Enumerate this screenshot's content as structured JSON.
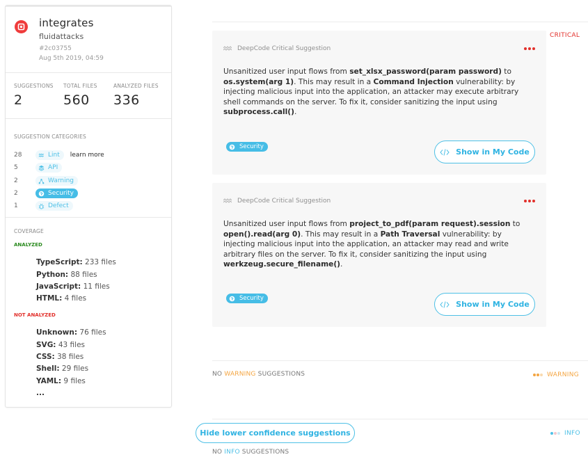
{
  "repo": {
    "name": "integrates",
    "owner": "fluidattacks",
    "commit": "#2c03755",
    "date": "Aug 5th 2019, 04:59"
  },
  "stats": [
    {
      "label": "SUGGESTIONS",
      "value": "2"
    },
    {
      "label": "TOTAL FILES",
      "value": "560"
    },
    {
      "label": "ANALYZED FILES",
      "value": "336"
    }
  ],
  "categories": {
    "title": "SUGGESTION CATEGORIES",
    "learn_more": "learn more",
    "items": [
      {
        "count": "28",
        "label": "Lint",
        "icon": "lint-icon"
      },
      {
        "count": "5",
        "label": "API",
        "icon": "api-icon"
      },
      {
        "count": "2",
        "label": "Warning",
        "icon": "warning-icon"
      },
      {
        "count": "2",
        "label": "Security",
        "icon": "security-icon"
      },
      {
        "count": "1",
        "label": "Defect",
        "icon": "bug-icon"
      }
    ]
  },
  "coverage": {
    "title": "COVERAGE",
    "analyzed_label": "ANALYZED",
    "analyzed": [
      {
        "lang": "TypeScript:",
        "files": "233 files"
      },
      {
        "lang": "Python:",
        "files": "88 files"
      },
      {
        "lang": "JavaScript:",
        "files": "11 files"
      },
      {
        "lang": "HTML:",
        "files": "4 files"
      }
    ],
    "not_analyzed_label": "NOT ANALYZED",
    "not_analyzed": [
      {
        "lang": "Unknown:",
        "files": "76 files"
      },
      {
        "lang": "SVG:",
        "files": "43 files"
      },
      {
        "lang": "CSS:",
        "files": "38 files"
      },
      {
        "lang": "Shell:",
        "files": "29 files"
      },
      {
        "lang": "YAML:",
        "files": "9 files"
      }
    ],
    "ellipsis": "..."
  },
  "severity": {
    "critical": "CRITICAL",
    "warning": "WARNING",
    "info": "INFO"
  },
  "suggestions": [
    {
      "header": "DeepCode Critical Suggestion",
      "t1": "Unsanitized user input flows from ",
      "b1": "set_xlsx_password(param password)",
      "t2": " to ",
      "b2": "os.system(arg 1)",
      "t3": ". This may result in a ",
      "b3": "Command Injection",
      "t4": " vulnerability: by injecting malicious input into the application, an attacker may execute arbitrary shell commands on the server. To fix it, consider sanitizing the input using ",
      "b4": "subprocess.call()",
      "t5": ".",
      "tag": "Security",
      "button": "Show in My Code"
    },
    {
      "header": "DeepCode Critical Suggestion",
      "t1": "Unsanitized user input flows from ",
      "b1": "project_to_pdf(param request).session",
      "t2": " to ",
      "b2": "open().read(arg 0)",
      "t3": ". This may result in a ",
      "b3": "Path Traversal",
      "t4": " vulnerability: by injecting malicious input into the application, an attacker may read and write arbitrary files on the server. To fix it, consider sanitizing the input using ",
      "b4": "werkzeug.secure_filename()",
      "t5": ".",
      "tag": "Security",
      "button": "Show in My Code"
    }
  ],
  "no_warning": {
    "pre": "NO ",
    "word": "WARNING",
    "post": " SUGGESTIONS"
  },
  "no_info": {
    "pre": "NO ",
    "word": "INFO",
    "post": " SUGGESTIONS"
  },
  "hide_button": "Hide lower confidence suggestions",
  "colors": {
    "accent": "#4ec0e6",
    "critical": "#e2302b",
    "warning": "#f4a541",
    "analyzed": "#2a8a1e"
  }
}
